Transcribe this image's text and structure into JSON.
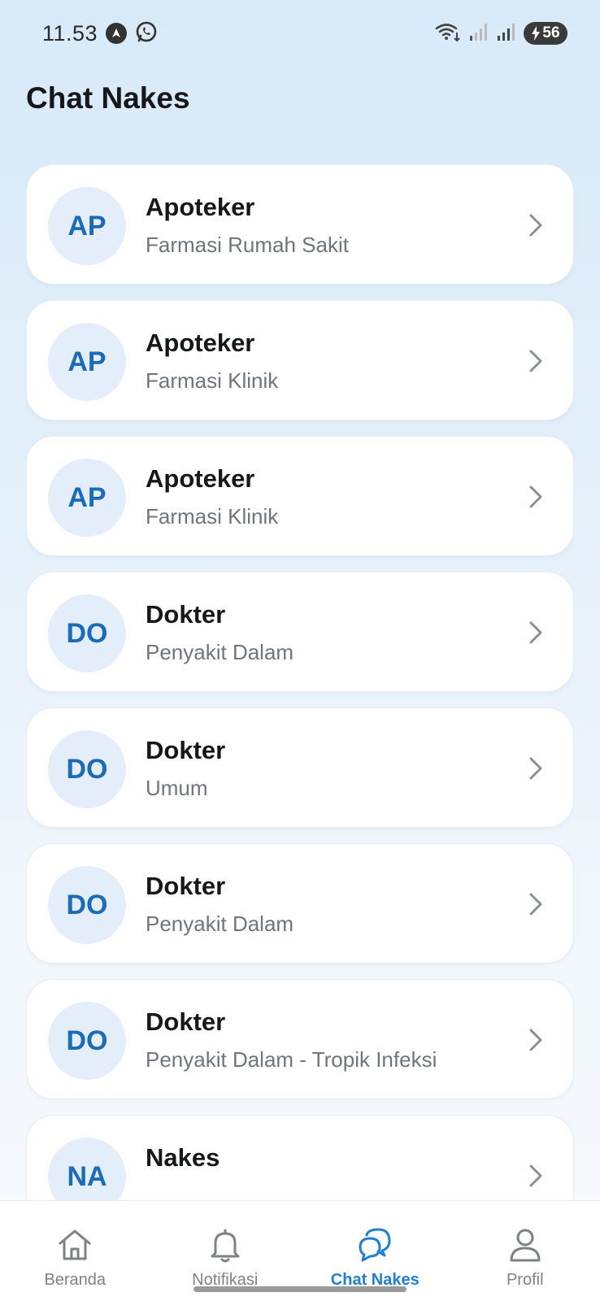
{
  "status_bar": {
    "time": "11.53",
    "battery": "56",
    "notification_icons": [
      "navigation-icon",
      "whatsapp-icon"
    ],
    "system_icons": [
      "wifi-icon",
      "signal-icon",
      "signal-icon"
    ]
  },
  "header": {
    "title": "Chat Nakes"
  },
  "contacts": [
    {
      "initials": "AP",
      "name": "Apoteker",
      "specialty": "Farmasi Rumah Sakit"
    },
    {
      "initials": "AP",
      "name": "Apoteker",
      "specialty": "Farmasi Klinik"
    },
    {
      "initials": "AP",
      "name": "Apoteker",
      "specialty": "Farmasi Klinik"
    },
    {
      "initials": "DO",
      "name": "Dokter",
      "specialty": "Penyakit Dalam"
    },
    {
      "initials": "DO",
      "name": "Dokter",
      "specialty": "Umum"
    },
    {
      "initials": "DO",
      "name": "Dokter",
      "specialty": "Penyakit Dalam"
    },
    {
      "initials": "DO",
      "name": "Dokter",
      "specialty": "Penyakit Dalam - Tropik Infeksi"
    },
    {
      "initials": "NA",
      "name": "Nakes",
      "specialty": ""
    }
  ],
  "bottom_nav": {
    "items": [
      {
        "label": "Beranda",
        "icon": "home-icon",
        "active": false
      },
      {
        "label": "Notifikasi",
        "icon": "bell-icon",
        "active": false
      },
      {
        "label": "Chat Nakes",
        "icon": "chat-icon",
        "active": true
      },
      {
        "label": "Profil",
        "icon": "user-icon",
        "active": false
      }
    ]
  },
  "colors": {
    "accent": "#1f7fd0",
    "avatar_bg": "#e3eefa",
    "avatar_text": "#1c6bb8"
  }
}
